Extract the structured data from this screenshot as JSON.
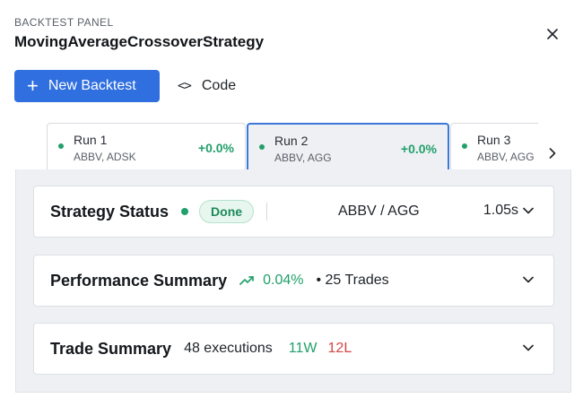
{
  "panel": {
    "label": "BACKTEST PANEL",
    "title": "MovingAverageCrossoverStrategy",
    "close_icon": "close-icon"
  },
  "toolbar": {
    "new_backtest_label": "New Backtest",
    "code_label": "Code"
  },
  "tabs": [
    {
      "name": "Run 1",
      "tickers": "ABBV, ADSK",
      "pct": "+0.0%",
      "active": false
    },
    {
      "name": "Run 2",
      "tickers": "ABBV, AGG",
      "pct": "+0.0%",
      "active": true
    },
    {
      "name": "Run 3",
      "tickers": "ABBV, AGG",
      "pct": "",
      "active": false
    }
  ],
  "status_card": {
    "title": "Strategy Status",
    "badge": "Done",
    "pair": "ABBV / AGG",
    "duration": "1.05s"
  },
  "performance_card": {
    "title": "Performance Summary",
    "pct": "0.04%",
    "trades": "• 25 Trades"
  },
  "trade_card": {
    "title": "Trade Summary",
    "executions": "48 executions",
    "wins": "11W",
    "losses": "12L"
  },
  "colors": {
    "primary": "#2f6fe0",
    "active_tab_border": "#3b78d8",
    "success": "#22a06b",
    "danger": "#d64545"
  }
}
